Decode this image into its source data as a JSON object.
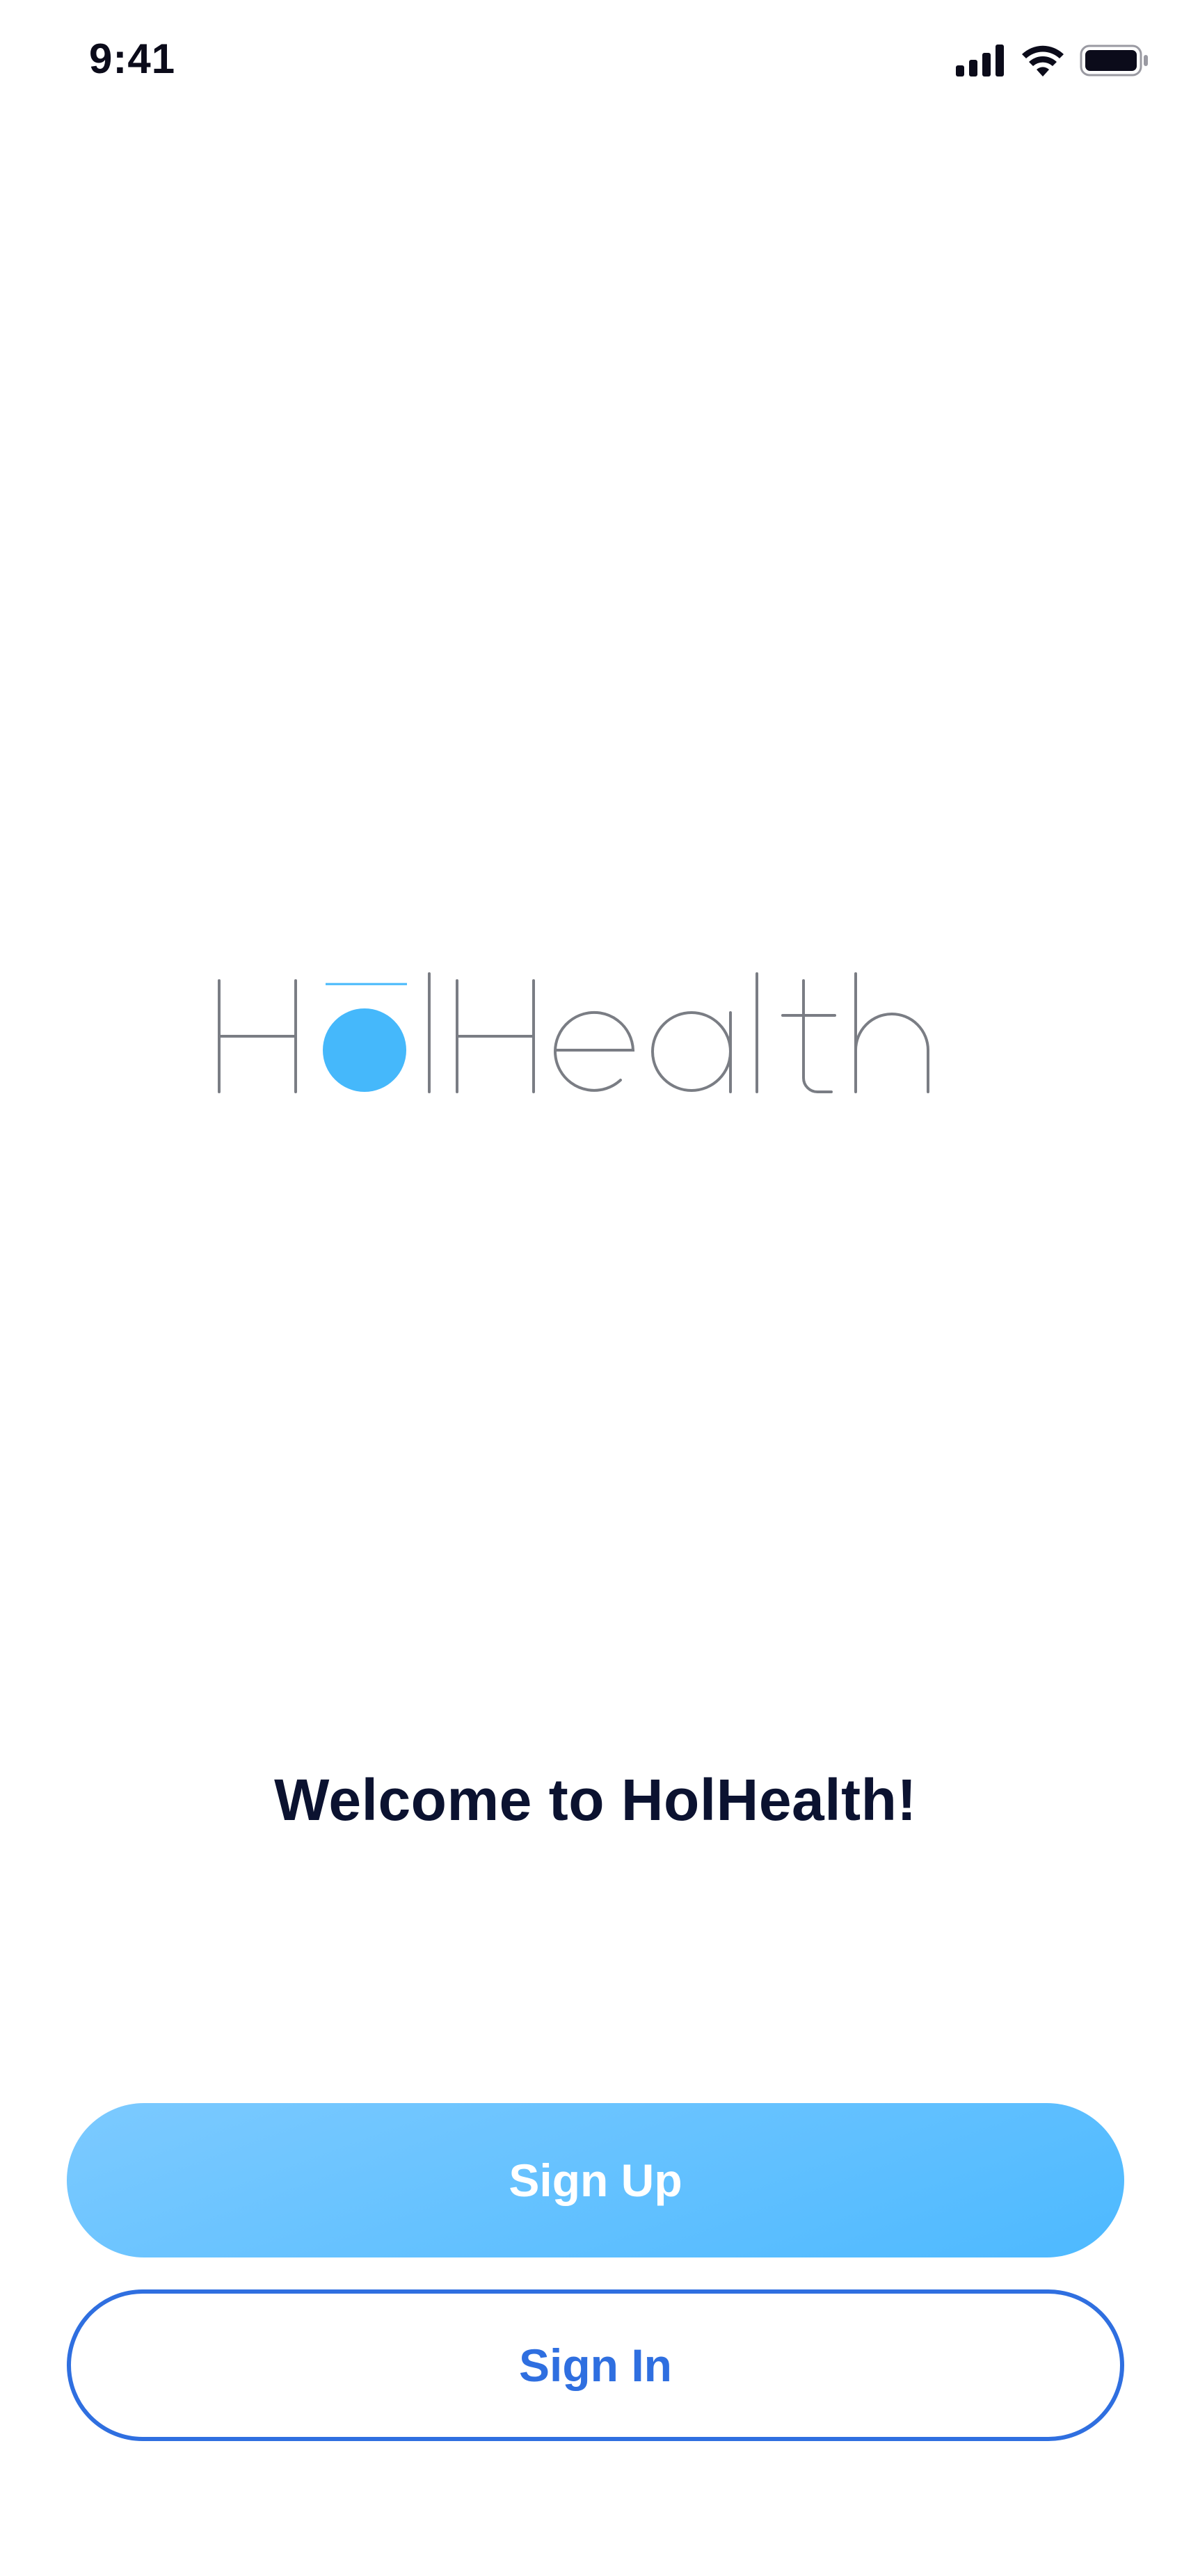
{
  "status_bar": {
    "time": "9:41",
    "icons": [
      "cellular-signal-icon",
      "wifi-icon",
      "battery-icon"
    ]
  },
  "logo": {
    "wordmark": "HolHealth",
    "colors": {
      "text": "#7a7d84",
      "accent": "#45b8fb"
    }
  },
  "welcome": {
    "title": "Welcome to HolHealth!"
  },
  "actions": {
    "sign_up_label": "Sign Up",
    "sign_in_label": "Sign In"
  },
  "colors": {
    "primary_gradient_start": "#7ccaff",
    "primary_gradient_end": "#4db9ff",
    "outline_blue": "#2f6fe0",
    "title_text": "#0b1230"
  }
}
